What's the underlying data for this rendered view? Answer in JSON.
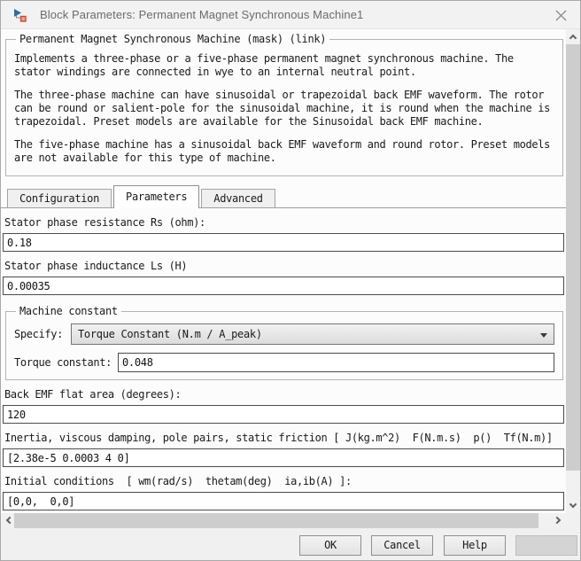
{
  "window": {
    "title": "Block Parameters: Permanent Magnet Synchronous Machine1"
  },
  "icons": {
    "app": "simulink-block-icon",
    "close": "close-icon",
    "combo": "chevron-down-icon"
  },
  "colors": {
    "titlebar_bg": "#f2f2f2",
    "content_bg": "#fcfcfc",
    "scroll_thumb": "#cdcdcd",
    "icon_blue": "#2e6f9e",
    "icon_red": "#c74a33"
  },
  "mask": {
    "frame_title": "Permanent Magnet Synchronous Machine (mask) (link)",
    "paragraphs": [
      "Implements a three-phase or a five-phase permanent magnet synchronous machine. The stator windings are connected in wye to an internal neutral point.",
      "The three-phase machine can have sinusoidal or trapezoidal back EMF waveform. The rotor can be round or salient-pole for the sinusoidal machine, it is round when the machine is trapezoidal. Preset models are available for the Sinusoidal back EMF machine.",
      "The five-phase machine has a sinusoidal back EMF waveform and round rotor. Preset models are not available for this type of machine."
    ]
  },
  "tabs": [
    {
      "label": "Configuration",
      "active": false
    },
    {
      "label": "Parameters",
      "active": true
    },
    {
      "label": "Advanced",
      "active": false
    }
  ],
  "fields": {
    "rs": {
      "label": "Stator phase resistance Rs (ohm):",
      "value": "0.18"
    },
    "ls": {
      "label": "Stator phase inductance Ls (H)",
      "value": "0.00035"
    },
    "machine_constant": {
      "group_title": "Machine constant",
      "specify_label": "Specify:",
      "specify_value": "Torque Constant (N.m / A_peak)",
      "torque_label": "Torque constant:",
      "torque_value": "0.048"
    },
    "back_emf": {
      "label": "Back EMF flat area (degrees):",
      "value": "120"
    },
    "inertia": {
      "label": "Inertia, viscous damping, pole pairs, static friction [ J(kg.m^2)  F(N.m.s)  p()  Tf(N.m)]",
      "value": "[2.38e-5 0.0003 4 0]"
    },
    "initial": {
      "label": "Initial conditions  [ wm(rad/s)  thetam(deg)  ia,ib(A) ]:",
      "value": "[0,0,  0,0]"
    }
  },
  "buttons": {
    "ok": "OK",
    "cancel": "Cancel",
    "help": "Help",
    "apply": ""
  }
}
